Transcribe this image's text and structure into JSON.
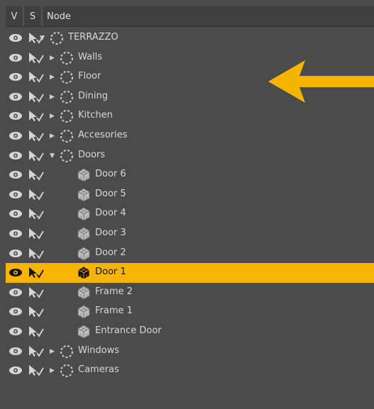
{
  "header": {
    "col_v": "V",
    "col_s": "S",
    "col_node": "Node"
  },
  "colors": {
    "accent": "#f7b400",
    "panel": "#4b4b4b",
    "header": "#3f3f3f"
  },
  "nodes": [
    {
      "label": "TERRAZZO",
      "level": 0,
      "expander": "expanded",
      "icon": "group-icon",
      "selected": false
    },
    {
      "label": "Walls",
      "level": 1,
      "expander": "collapsed",
      "icon": "group-icon",
      "selected": false
    },
    {
      "label": "Floor",
      "level": 1,
      "expander": "collapsed",
      "icon": "group-icon",
      "selected": false
    },
    {
      "label": "Dining",
      "level": 1,
      "expander": "collapsed",
      "icon": "group-icon",
      "selected": false
    },
    {
      "label": "Kitchen",
      "level": 1,
      "expander": "collapsed",
      "icon": "group-icon",
      "selected": false
    },
    {
      "label": "Accesories",
      "level": 1,
      "expander": "collapsed",
      "icon": "group-icon",
      "selected": false
    },
    {
      "label": "Doors",
      "level": 1,
      "expander": "expanded",
      "icon": "group-icon",
      "selected": false
    },
    {
      "label": "Door 6",
      "level": 2,
      "expander": "none",
      "icon": "mesh-icon",
      "selected": false
    },
    {
      "label": "Door 5",
      "level": 2,
      "expander": "none",
      "icon": "mesh-icon",
      "selected": false
    },
    {
      "label": "Door 4",
      "level": 2,
      "expander": "none",
      "icon": "mesh-icon",
      "selected": false
    },
    {
      "label": "Door 3",
      "level": 2,
      "expander": "none",
      "icon": "mesh-icon",
      "selected": false
    },
    {
      "label": "Door 2",
      "level": 2,
      "expander": "none",
      "icon": "mesh-icon",
      "selected": false
    },
    {
      "label": "Door 1",
      "level": 2,
      "expander": "none",
      "icon": "mesh-icon",
      "selected": true
    },
    {
      "label": "Frame 2",
      "level": 2,
      "expander": "none",
      "icon": "mesh-icon",
      "selected": false
    },
    {
      "label": "Frame 1",
      "level": 2,
      "expander": "none",
      "icon": "mesh-icon",
      "selected": false
    },
    {
      "label": "Entrance Door",
      "level": 2,
      "expander": "none",
      "icon": "mesh-icon",
      "selected": false
    },
    {
      "label": "Windows",
      "level": 1,
      "expander": "collapsed",
      "icon": "group-icon",
      "selected": false
    },
    {
      "label": "Cameras",
      "level": 1,
      "expander": "collapsed",
      "icon": "group-icon",
      "selected": false
    }
  ],
  "callout_icon": "arrow-left-icon"
}
